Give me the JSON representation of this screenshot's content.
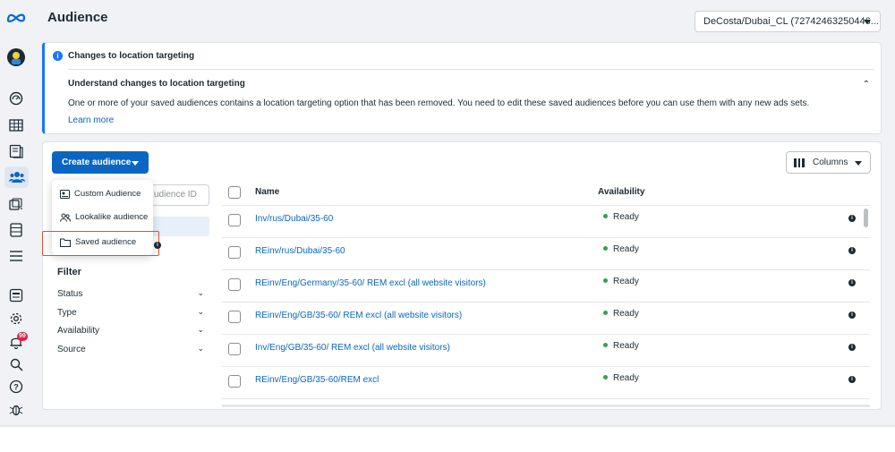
{
  "header": {
    "title": "Audience",
    "account_selector": "DeCosta/Dubai_CL (72742463250446..."
  },
  "sidebar": {
    "notification_count": "99",
    "icons": [
      "meta-logo-icon",
      "avatar",
      "speedometer-icon",
      "table-grid-icon",
      "pages-icon",
      "audience-icon",
      "ads-library-icon",
      "database-icon",
      "menu-icon",
      "page-icon",
      "settings-gear-icon",
      "notifications-bell-icon",
      "search-icon",
      "help-icon",
      "bug-icon"
    ]
  },
  "notice": {
    "title": "Changes to location targeting",
    "subtitle": "Understand changes to location targeting",
    "body": "One or more of your saved audiences contains a location targeting option that has been removed. You need to edit these saved audiences before you can use them with any new ads sets.",
    "link": "Learn more"
  },
  "toolbar": {
    "create_label": "Create audience",
    "columns_label": "Columns",
    "search_placeholder": "udience ID"
  },
  "dropdown": {
    "items": [
      {
        "label": "Custom Audience",
        "icon": "custom-audience-icon"
      },
      {
        "label": "Lookalike audience",
        "icon": "lookalike-audience-icon"
      },
      {
        "label": "Saved audience",
        "icon": "folder-icon"
      }
    ]
  },
  "filter": {
    "title": "Filter",
    "items": [
      "Status",
      "Type",
      "Availability",
      "Source"
    ]
  },
  "table": {
    "headers": {
      "name": "Name",
      "availability": "Availability"
    },
    "rows": [
      {
        "name": "Inv/rus/Dubai/35-60",
        "status": "Ready"
      },
      {
        "name": "REinv/rus/Dubai/35-60",
        "status": "Ready"
      },
      {
        "name": "REinv/Eng/Germany/35-60/ REM excl (all website visitors)",
        "status": "Ready"
      },
      {
        "name": "REinv/Eng/GB/35-60/ REM excl (all website visitors)",
        "status": "Ready"
      },
      {
        "name": "Inv/Eng/GB/35-60/ REM excl (all website visitors)",
        "status": "Ready"
      },
      {
        "name": "REinv/Eng/GB/35-60/REM excl",
        "status": "Ready"
      }
    ]
  },
  "colors": {
    "accent": "#0a66c2",
    "status_ready": "#31a24c",
    "highlight_box": "#e0502d"
  }
}
